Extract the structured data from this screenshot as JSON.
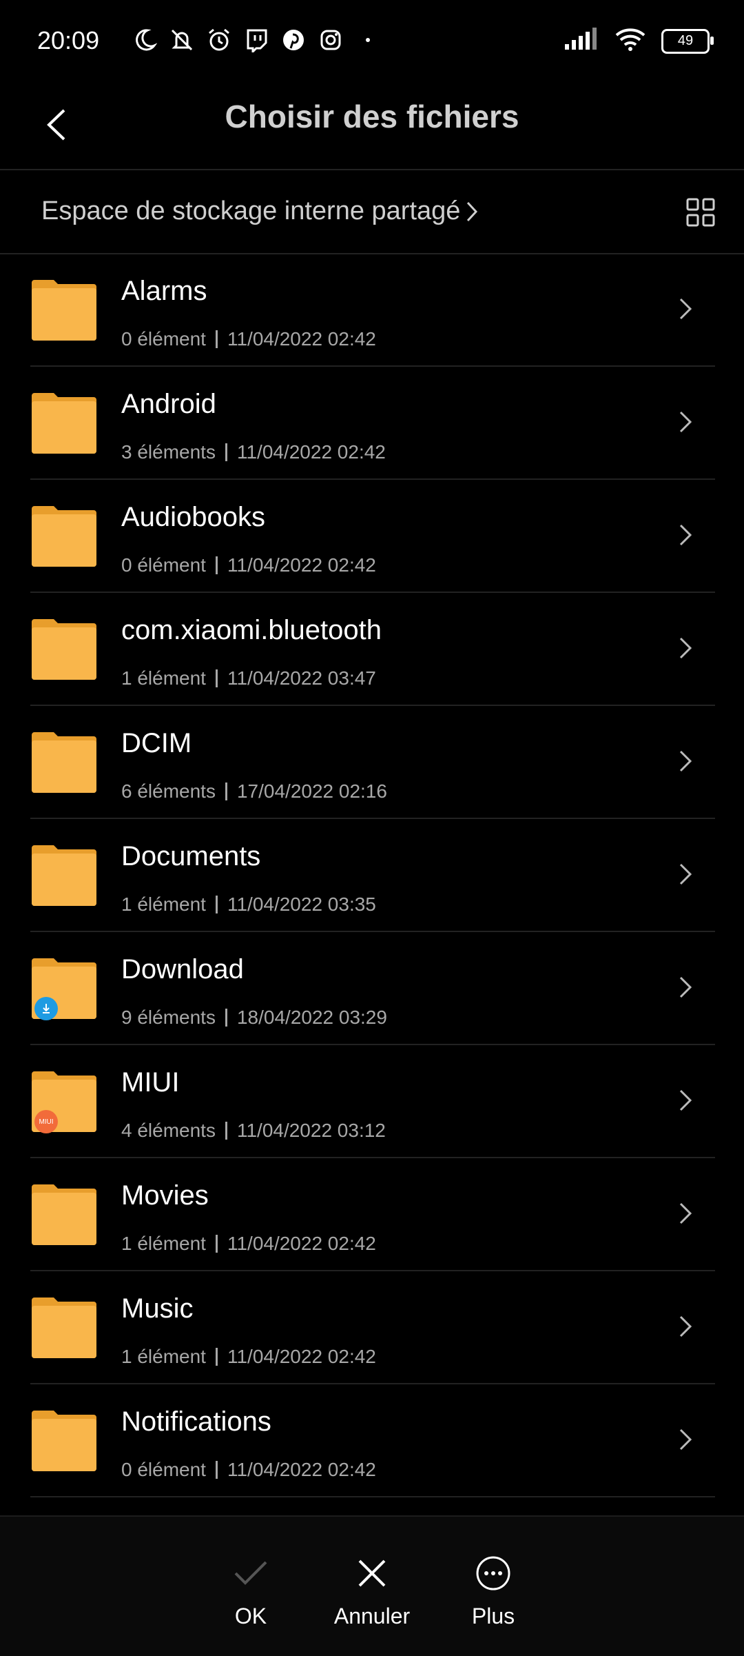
{
  "status_bar": {
    "time": "20:09",
    "battery": "49",
    "icons_left": [
      "moon-icon",
      "mute-icon",
      "alarm-icon",
      "twitch-icon",
      "pinterest-icon",
      "instagram-icon",
      "dot-icon"
    ],
    "icons_right": [
      "signal-icon",
      "wifi-icon",
      "battery-icon"
    ]
  },
  "header": {
    "title": "Choisir des fichiers"
  },
  "path": {
    "label": "Espace de stockage interne partagé"
  },
  "folders": [
    {
      "name": "Alarms",
      "count": "0 élément",
      "date": "11/04/2022 02:42",
      "badge": ""
    },
    {
      "name": "Android",
      "count": "3 éléments",
      "date": "11/04/2022 02:42",
      "badge": ""
    },
    {
      "name": "Audiobooks",
      "count": "0 élément",
      "date": "11/04/2022 02:42",
      "badge": ""
    },
    {
      "name": "com.xiaomi.bluetooth",
      "count": "1 élément",
      "date": "11/04/2022 03:47",
      "badge": ""
    },
    {
      "name": "DCIM",
      "count": "6 éléments",
      "date": "17/04/2022 02:16",
      "badge": ""
    },
    {
      "name": "Documents",
      "count": "1 élément",
      "date": "11/04/2022 03:35",
      "badge": ""
    },
    {
      "name": "Download",
      "count": "9 éléments",
      "date": "18/04/2022 03:29",
      "badge": "download"
    },
    {
      "name": "MIUI",
      "count": "4 éléments",
      "date": "11/04/2022 03:12",
      "badge": "miui"
    },
    {
      "name": "Movies",
      "count": "1 élément",
      "date": "11/04/2022 02:42",
      "badge": ""
    },
    {
      "name": "Music",
      "count": "1 élément",
      "date": "11/04/2022 02:42",
      "badge": ""
    },
    {
      "name": "Notifications",
      "count": "0 élément",
      "date": "11/04/2022 02:42",
      "badge": ""
    }
  ],
  "badges": {
    "miui_text": "MIUI"
  },
  "bottom_bar": {
    "ok_label": "OK",
    "cancel_label": "Annuler",
    "more_label": "Plus"
  },
  "colors": {
    "folder": "#F9B64B",
    "folder_tab": "#E89E2C",
    "background": "#000000",
    "secondary_text": "#A8A8A8"
  }
}
